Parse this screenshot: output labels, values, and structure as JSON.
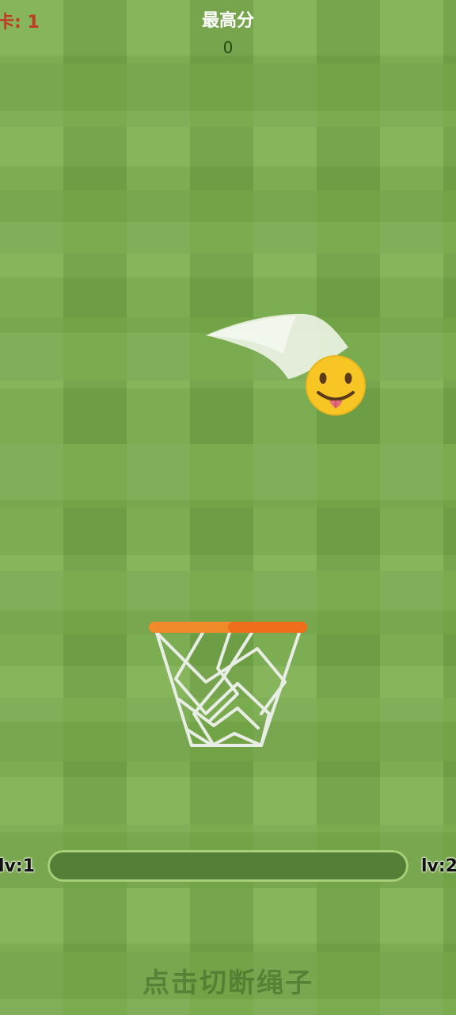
{
  "hud": {
    "level_label": "卡: 1",
    "best_title": "最高分",
    "best_score": "0"
  },
  "progress": {
    "left_label": "lv:1",
    "right_label": "lv:2",
    "value": 0
  },
  "hint": {
    "text": "点击切断绳子"
  },
  "scene": {
    "ball_icon": "tongue-out-face-icon",
    "hoop_rim_color": "#f08a2a",
    "net_color": "#e7ece6"
  }
}
